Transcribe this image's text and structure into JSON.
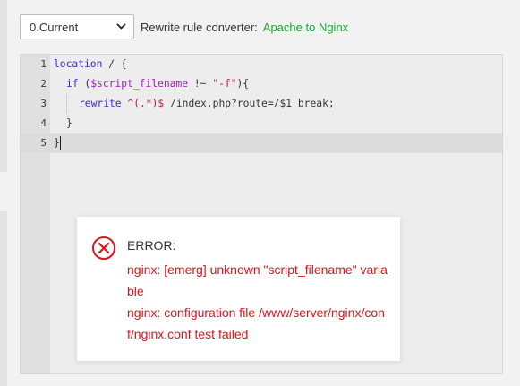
{
  "toolbar": {
    "version_selected": "0.Current",
    "converter_label": "Rewrite rule converter:",
    "converter_link": "Apache to Nginx"
  },
  "editor": {
    "lines": [
      {
        "num": "1"
      },
      {
        "num": "2"
      },
      {
        "num": "3"
      },
      {
        "num": "4"
      },
      {
        "num": "5"
      }
    ],
    "tokens": {
      "l1_kw": "location",
      "l1_rest": " / {",
      "l2_kw": "if",
      "l2_open": " (",
      "l2_var": "$script_filename",
      "l2_op": " !~ ",
      "l2_str": "\"-f\"",
      "l2_close": "){",
      "l3_kw": "rewrite",
      "l3_sp": " ",
      "l3_regex": "^(.*)$",
      "l3_rest": " /index.php?route=/$1 break;",
      "l4_text": "}",
      "l5_text": "}"
    }
  },
  "dialog": {
    "title": "ERROR:",
    "line1": "nginx: [emerg] unknown \"script_filename\" variable",
    "line2": "nginx: configuration file /www/server/nginx/conf/nginx.conf test failed"
  },
  "colors": {
    "accent_green": "#20a53a",
    "error_red": "#e0121c"
  }
}
